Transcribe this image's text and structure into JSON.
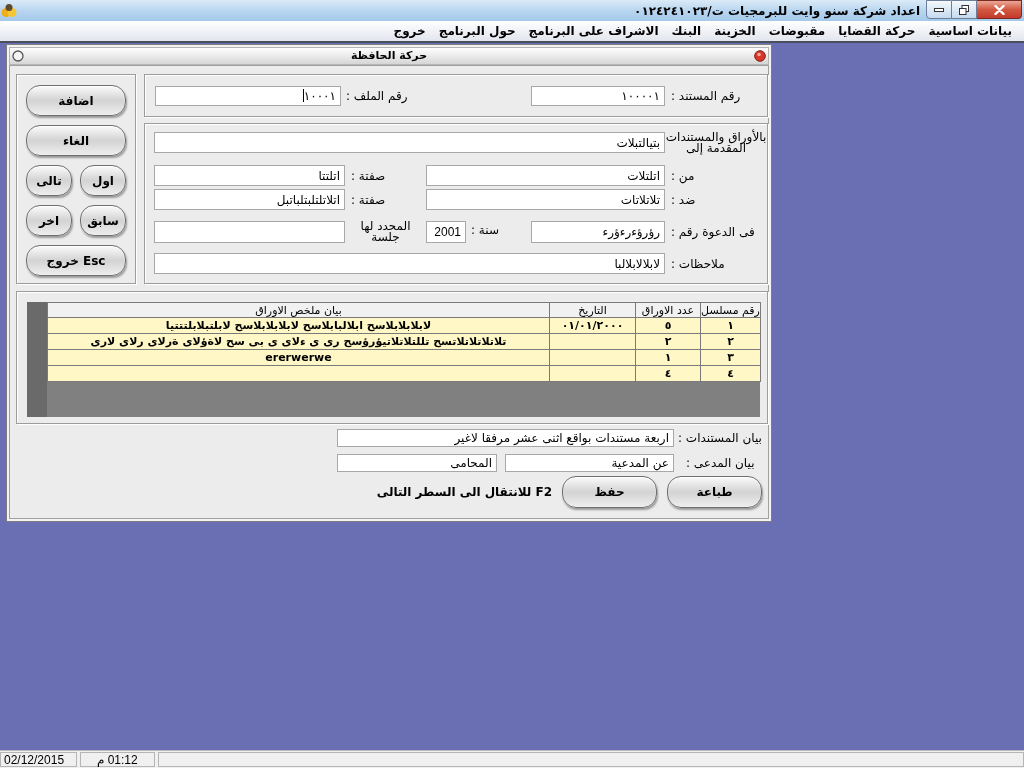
{
  "window": {
    "title": "اعداد شركة سنو وايت للبرمجيات ت/٠١٢٤٢٤١٠٢٣"
  },
  "menu": [
    "بيانات اساسية",
    "حركة القضايا",
    "مقبوضات",
    "الخزينة",
    "البنك",
    "الاشراف على البرنامج",
    "حول البرنامج",
    "خروج"
  ],
  "form": {
    "title": "حركة الحافظة"
  },
  "side_buttons": [
    {
      "label": "اضافة",
      "kind": "wide"
    },
    {
      "label": "الغاء",
      "kind": "wide"
    },
    {
      "label": "اول",
      "kind": "half"
    },
    {
      "label": "تالى",
      "kind": "half"
    },
    {
      "label": "سابق",
      "kind": "half"
    },
    {
      "label": "اخر",
      "kind": "half"
    },
    {
      "label": "Esc خروج",
      "kind": "wide"
    }
  ],
  "header": {
    "document_no": {
      "label": "رقم المستند :",
      "value": "١٠٠٠٠١"
    },
    "file_no": {
      "label": "رقم الملف :",
      "value": "١٠٠٠١",
      "focused": true
    }
  },
  "details": {
    "submitted_to": {
      "label": "بالأوراق والمستندات المقدمة إلى",
      "value": "بتيالتبلات"
    },
    "from": {
      "label": "من :",
      "value": "اتلتلات"
    },
    "from_capacity": {
      "label": "صفتة :",
      "value": "اتلتتا"
    },
    "against": {
      "label": "ضد :",
      "value": "تلاتلاتات"
    },
    "against_capacity": {
      "label": "صفتة :",
      "value": "اتلاتلتلبتلباتبل"
    },
    "case_no": {
      "label": "فى الدعوة رقم :",
      "value": "رؤرؤءرءؤرء"
    },
    "year": {
      "label": "سنة :",
      "value": "2001"
    },
    "session": {
      "label": "المحدد لها جلسة"
    },
    "notes": {
      "label": "ملاحظات :",
      "value": "لابلالابلالبا"
    }
  },
  "table": {
    "columns": [
      "رقم مسلسل",
      "عدد الاوراق",
      "التاريخ",
      "بيان ملخص الاوراق"
    ],
    "rows": [
      {
        "serial": "١",
        "pages": "٥",
        "date": "٠١/٠١/٢٠٠٠",
        "summary": "لابلابلابلاسح ابلالبابلاسح لابلابلابلاسح لابلتبلابلتتتيا"
      },
      {
        "serial": "٢",
        "pages": "٢",
        "summary": "تلاتلاتلاتلاتسح تللتلاتلاتيؤرؤسح رى ى ءلاى ى بى سح لاةؤلاى ةرلاى رلاى لارى"
      },
      {
        "serial": "٣",
        "pages": "١",
        "summary": "ererwerwe"
      },
      {
        "serial": "٤",
        "pages": "٤"
      }
    ]
  },
  "documents_statement": {
    "label": "بيان المستندات :",
    "value": "اربعة مستندات بواقع اثنى عشر مرفقا لاغير"
  },
  "plaintiff_statement": {
    "label": "بيان المدعى :",
    "values": [
      "عن المدعية",
      "المحامى"
    ]
  },
  "actions": [
    "طباعة",
    "حفظ"
  ],
  "hint": "F2 للانتقال الى السطر التالى",
  "status_bar": {
    "date": "02/12/2015",
    "time": "01:12 م"
  }
}
